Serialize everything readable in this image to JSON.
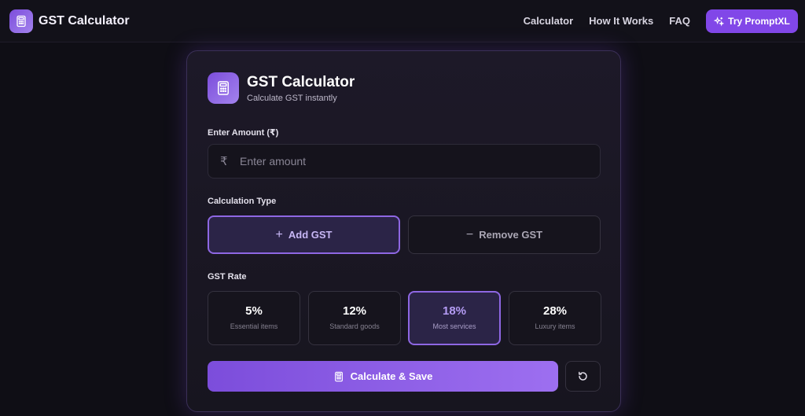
{
  "nav": {
    "brand_title": "GST Calculator",
    "links": [
      "Calculator",
      "How It Works",
      "FAQ"
    ],
    "cta_label": "Try PromptXL"
  },
  "card": {
    "title": "GST Calculator",
    "subtitle": "Calculate GST instantly",
    "amount_label": "Enter Amount (₹)",
    "currency_symbol": "₹",
    "amount_placeholder": "Enter amount",
    "amount_value": "",
    "calc_type_label": "Calculation Type",
    "calc_types": [
      {
        "symbol": "+",
        "label": "Add GST",
        "selected": true
      },
      {
        "symbol": "−",
        "label": "Remove GST",
        "selected": false
      }
    ],
    "rate_label": "GST Rate",
    "rates": [
      {
        "pct": "5%",
        "desc": "Essential items",
        "selected": false
      },
      {
        "pct": "12%",
        "desc": "Standard goods",
        "selected": false
      },
      {
        "pct": "18%",
        "desc": "Most services",
        "selected": true
      },
      {
        "pct": "28%",
        "desc": "Luxury items",
        "selected": false
      }
    ],
    "calculate_label": "Calculate & Save"
  },
  "colors": {
    "accent": "#8147e8",
    "accent_light": "#a383ee",
    "background": "#0f0e15",
    "card_bg": "#1b1825",
    "selected_border": "#8e67e3"
  },
  "icons": {
    "brand": "calculator-icon",
    "cta": "sparkles-icon",
    "calculate": "calculator-icon",
    "reset": "refresh-icon"
  }
}
